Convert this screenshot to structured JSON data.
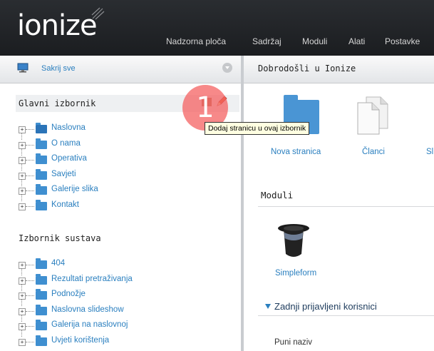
{
  "app": {
    "logo": "ionize"
  },
  "nav": {
    "items": [
      "Nadzorna ploča",
      "Sadržaj",
      "Moduli",
      "Alati",
      "Postavke"
    ]
  },
  "left_panel": {
    "hide_all": "Sakrij sve",
    "main_menu": {
      "title": "Glavni izbornik",
      "items": [
        "Naslovna",
        "O nama",
        "Operativa",
        "Savjeti",
        "Galerije slika",
        "Kontakt"
      ]
    },
    "system_menu": {
      "title": "Izbornik sustava",
      "items": [
        "404",
        "Rezultati pretraživanja",
        "Podnožje",
        "Naslovna slideshow",
        "Galerija na naslovnoj",
        "Uvjeti korištenja"
      ]
    },
    "tooltip": "Dodaj stranicu u ovaj izbornik",
    "badge": "1"
  },
  "right_panel": {
    "welcome": "Dobrodošli u Ionize",
    "tiles": [
      "Nova stranica",
      "Članci",
      "Sl"
    ],
    "modules_title": "Moduli",
    "module_items": [
      "Simpleform"
    ],
    "last_users_title": "Zadnji prijavljeni korisnici",
    "full_name": "Puni naziv"
  },
  "colors": {
    "link": "#2a7fbf",
    "topbar": "#1f2124",
    "badge": "#f46262"
  }
}
